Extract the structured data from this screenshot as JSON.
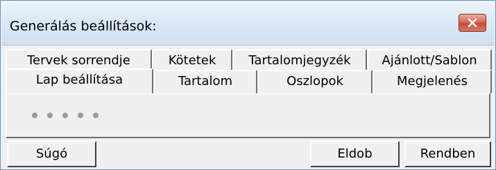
{
  "window": {
    "title": "Generálás beállítások:",
    "close_label": "Close"
  },
  "tabs": {
    "back_row": [
      {
        "label": "Tervek sorrendje"
      },
      {
        "label": "Kötetek"
      },
      {
        "label": "Tartalomjegyzék"
      },
      {
        "label": "Ajánlott/Sablon"
      }
    ],
    "front_row": [
      {
        "label": "Lap beállítása",
        "selected": true
      },
      {
        "label": "Tartalom"
      },
      {
        "label": "Oszlopok"
      },
      {
        "label": "Megjelenés"
      }
    ]
  },
  "panel": {
    "indicator_dots": 5
  },
  "buttons": {
    "help_label": "Súgó",
    "discard_label": "Eldob",
    "ok_label": "Rendben"
  },
  "colors": {
    "title_bar": "#dbe8f6",
    "close_button": "#d56a55",
    "background": "#f0f0f0"
  }
}
